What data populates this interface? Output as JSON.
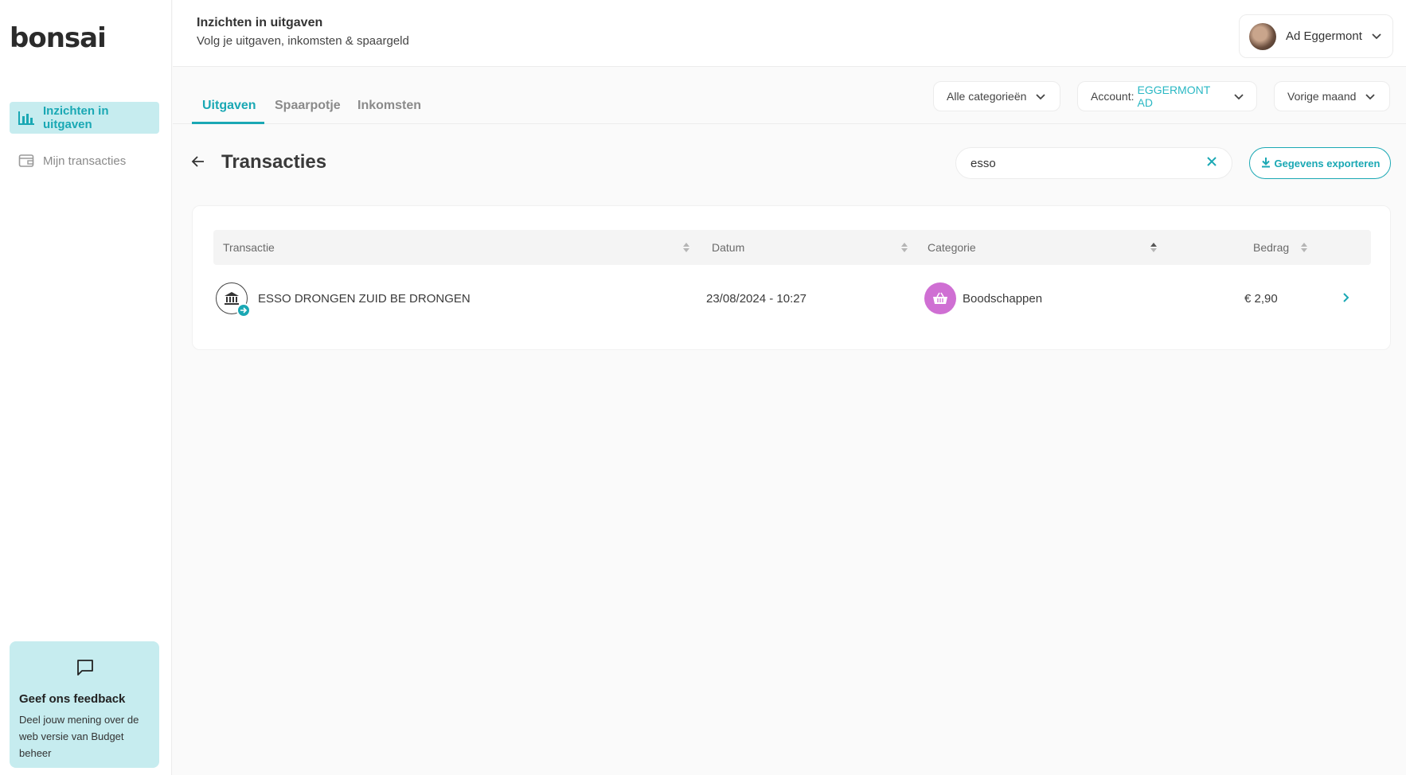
{
  "app": {
    "logo": "bonsai"
  },
  "sidebar": {
    "items": [
      {
        "label": "Inzichten in uitgaven",
        "icon": "bar-chart-icon",
        "active": true
      },
      {
        "label": "Mijn transacties",
        "icon": "wallet-icon",
        "active": false
      }
    ],
    "feedback": {
      "icon": "speech-bubble-icon",
      "title": "Geef ons feedback",
      "text": "Deel jouw mening over de web versie van Budget beheer"
    }
  },
  "header": {
    "title": "Inzichten in uitgaven",
    "subtitle": "Volg je uitgaven, inkomsten & spaargeld",
    "user": {
      "name": "Ad Eggermont"
    }
  },
  "tabs": [
    {
      "label": "Uitgaven",
      "active": true
    },
    {
      "label": "Spaarpotje",
      "active": false
    },
    {
      "label": "Inkomsten",
      "active": false
    }
  ],
  "filters": {
    "category": "Alle categorieën",
    "account_label": "Account:",
    "account_value": "EGGERMONT AD",
    "period": "Vorige maand"
  },
  "page": {
    "title": "Transacties",
    "search_value": "esso",
    "export_label": "Gegevens exporteren"
  },
  "table": {
    "columns": [
      "Transactie",
      "Datum",
      "Categorie",
      "Bedrag"
    ],
    "rows": [
      {
        "transactie": "ESSO DRONGEN ZUID BE DRONGEN",
        "datum": "23/08/2024 - 10:27",
        "categorie": "Boodschappen",
        "bedrag": "€ 2,90"
      }
    ]
  },
  "colors": {
    "accent": "#1aa8b4",
    "active_nav_bg": "#c6ecef",
    "category_boodschappen": "#cf6fd3"
  }
}
